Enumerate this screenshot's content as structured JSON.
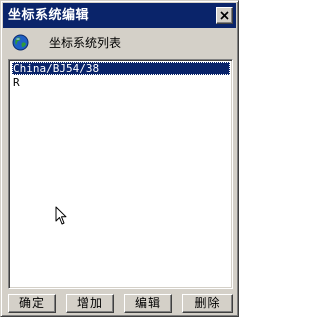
{
  "window": {
    "title": "坐标系统编辑",
    "close_glyph": "×"
  },
  "header": {
    "icon": "globe-icon",
    "title": "坐标系统列表"
  },
  "list": {
    "items": [
      {
        "label": "China/BJ54/38",
        "selected": true
      },
      {
        "label": "R",
        "selected": false
      }
    ]
  },
  "buttons": {
    "ok": "确定",
    "add": "增加",
    "edit": "编辑",
    "delete": "删除"
  },
  "colors": {
    "titlebar": "#0a246a",
    "selection": "#0a246a",
    "face": "#d4d0c8"
  }
}
